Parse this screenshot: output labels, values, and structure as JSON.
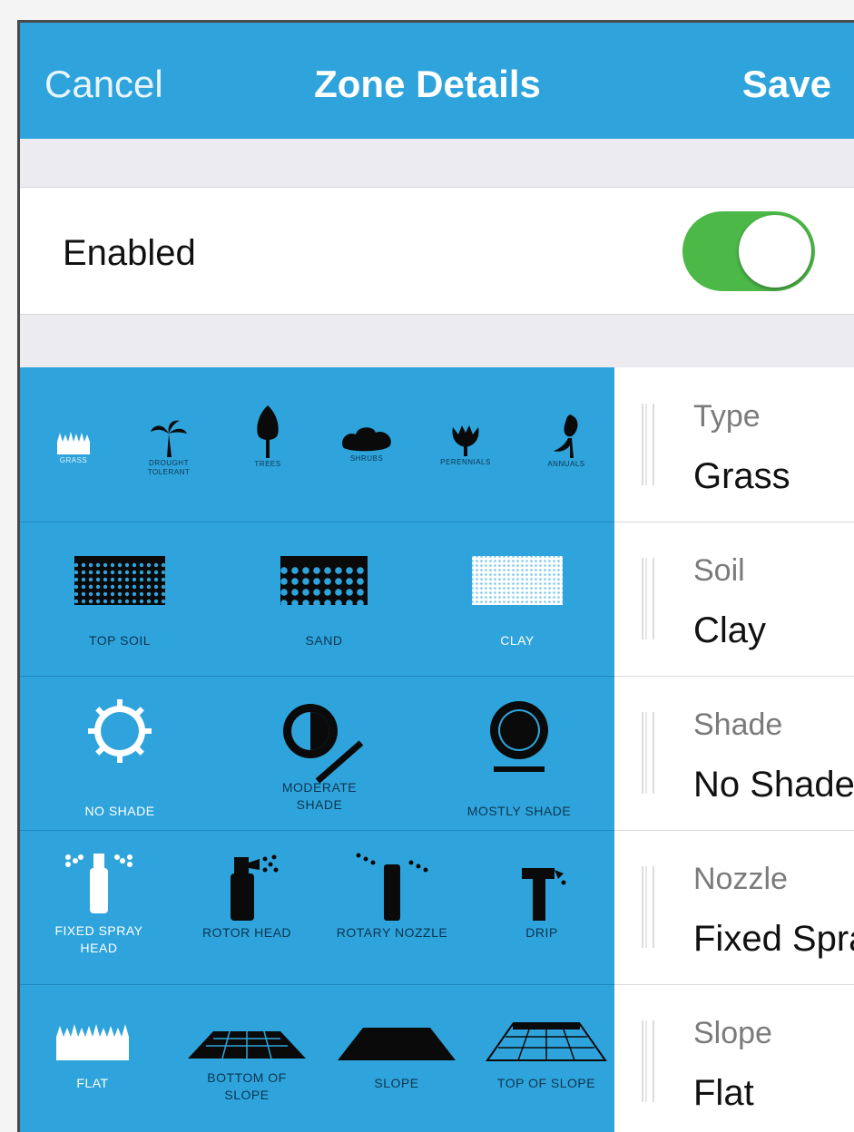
{
  "navbar": {
    "cancel": "Cancel",
    "title": "Zone Details",
    "save": "Save"
  },
  "enabled": {
    "label": "Enabled",
    "on": true
  },
  "colors": {
    "accent": "#2fa4dc",
    "toggle_on": "#4cb848"
  },
  "picker": {
    "vegetation": [
      {
        "label": "Grass",
        "icon": "grass-icon",
        "selected": true
      },
      {
        "label": "Drought tolerant",
        "icon": "palm-icon"
      },
      {
        "label": "Trees",
        "icon": "tree-icon"
      },
      {
        "label": "Shrubs",
        "icon": "shrub-icon"
      },
      {
        "label": "Perennials",
        "icon": "flower-icon"
      },
      {
        "label": "Annuals",
        "icon": "annual-icon"
      }
    ],
    "soil": [
      {
        "label": "TOP SOIL",
        "icon": "topsoil-icon"
      },
      {
        "label": "SAND",
        "icon": "sand-icon"
      },
      {
        "label": "CLAY",
        "icon": "clay-icon",
        "selected": true
      }
    ],
    "shade": [
      {
        "label": "NO SHADE",
        "icon": "no-shade-icon",
        "selected": true
      },
      {
        "label": "MODERATE SHADE",
        "icon": "moderate-shade-icon"
      },
      {
        "label": "MOSTLY SHADE",
        "icon": "mostly-shade-icon"
      }
    ],
    "nozzle": [
      {
        "label": "FIXED SPRAY HEAD",
        "icon": "fixed-spray-head-icon",
        "selected": true
      },
      {
        "label": "ROTOR HEAD",
        "icon": "rotor-head-icon"
      },
      {
        "label": "ROTARY NOZZLE",
        "icon": "rotary-nozzle-icon"
      },
      {
        "label": "DRIP",
        "icon": "drip-icon"
      }
    ],
    "slope": [
      {
        "label": "FLAT",
        "icon": "flat-icon",
        "selected": true
      },
      {
        "label": "BOTTOM OF SLOPE",
        "icon": "bottom-of-slope-icon"
      },
      {
        "label": "SLOPE",
        "icon": "slope-icon"
      },
      {
        "label": "TOP OF SLOPE",
        "icon": "top-of-slope-icon"
      }
    ]
  },
  "settings": [
    {
      "label": "Type",
      "value": "Grass"
    },
    {
      "label": "Soil",
      "value": "Clay"
    },
    {
      "label": "Shade",
      "value": "No Shade"
    },
    {
      "label": "Nozzle",
      "value": "Fixed Spray Head"
    },
    {
      "label": "Slope",
      "value": "Flat"
    }
  ]
}
